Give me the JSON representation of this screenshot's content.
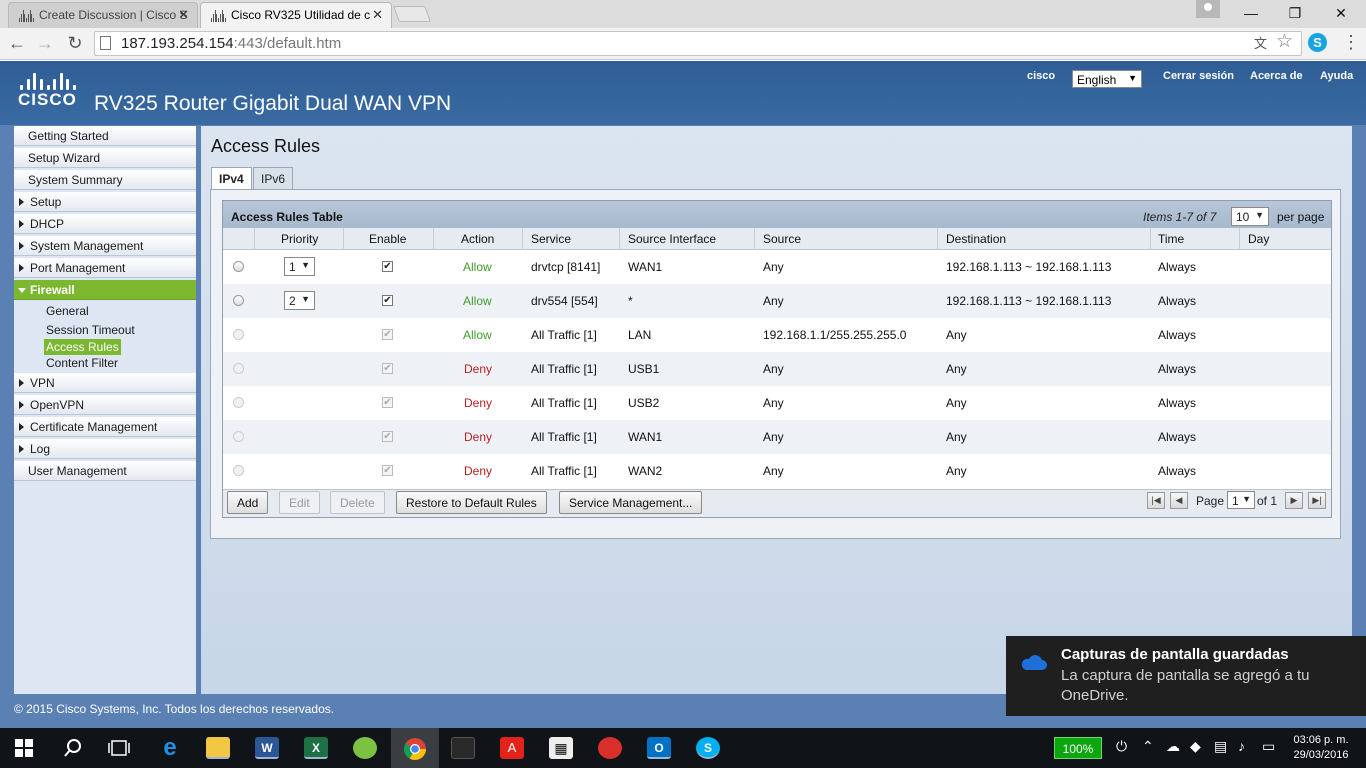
{
  "browser": {
    "tabs": [
      {
        "title": "Create Discussion | Cisco S",
        "active": false
      },
      {
        "title": "Cisco RV325 Utilidad de c",
        "active": true
      }
    ],
    "url_host": "187.193.254.154",
    "url_rest": ":443/default.htm"
  },
  "header": {
    "logo": "CISCO",
    "product": "RV325  Router Gigabit Dual WAN VPN",
    "user": "cisco",
    "language": "English",
    "logout": "Cerrar sesión",
    "about": "Acerca de",
    "help": "Ayuda"
  },
  "nav": {
    "items": [
      {
        "label": "Getting Started",
        "expandable": false
      },
      {
        "label": "Setup Wizard",
        "expandable": false
      },
      {
        "label": "System Summary",
        "expandable": false
      },
      {
        "label": "Setup",
        "expandable": true
      },
      {
        "label": "DHCP",
        "expandable": true
      },
      {
        "label": "System Management",
        "expandable": true
      },
      {
        "label": "Port Management",
        "expandable": true
      },
      {
        "label": "Firewall",
        "expandable": true,
        "active": true
      },
      {
        "label": "VPN",
        "expandable": true
      },
      {
        "label": "OpenVPN",
        "expandable": true
      },
      {
        "label": "Certificate Management",
        "expandable": true
      },
      {
        "label": "Log",
        "expandable": true
      },
      {
        "label": "User Management",
        "expandable": false
      }
    ],
    "firewall_sub": [
      "General",
      "Session Timeout",
      "Access Rules",
      "Content Filter"
    ],
    "selected_sub": "Access Rules"
  },
  "main": {
    "title": "Access Rules",
    "tabs": [
      "IPv4",
      "IPv6"
    ],
    "active_tab": "IPv4",
    "table_title": "Access Rules Table",
    "items_info": "Items 1-7 of 7",
    "per_page_value": "10",
    "per_page_label": "per page",
    "columns": [
      "Priority",
      "Enable",
      "Action",
      "Service",
      "Source Interface",
      "Source",
      "Destination",
      "Time",
      "Day"
    ],
    "rows": [
      {
        "priority": "1",
        "enabled": true,
        "editable": true,
        "action": "Allow",
        "service": "drvtcp [8141]",
        "source_interface": "WAN1",
        "source": "Any",
        "destination": "192.168.1.113 ~ 192.168.1.113",
        "time": "Always",
        "day": ""
      },
      {
        "priority": "2",
        "enabled": true,
        "editable": true,
        "action": "Allow",
        "service": "drv554 [554]",
        "source_interface": "*",
        "source": "Any",
        "destination": "192.168.1.113 ~ 192.168.1.113",
        "time": "Always",
        "day": ""
      },
      {
        "priority": "",
        "enabled": true,
        "editable": false,
        "action": "Allow",
        "service": "All Traffic [1]",
        "source_interface": "LAN",
        "source": "192.168.1.1/255.255.255.0",
        "destination": "Any",
        "time": "Always",
        "day": ""
      },
      {
        "priority": "",
        "enabled": true,
        "editable": false,
        "action": "Deny",
        "service": "All Traffic [1]",
        "source_interface": "USB1",
        "source": "Any",
        "destination": "Any",
        "time": "Always",
        "day": ""
      },
      {
        "priority": "",
        "enabled": true,
        "editable": false,
        "action": "Deny",
        "service": "All Traffic [1]",
        "source_interface": "USB2",
        "source": "Any",
        "destination": "Any",
        "time": "Always",
        "day": ""
      },
      {
        "priority": "",
        "enabled": true,
        "editable": false,
        "action": "Deny",
        "service": "All Traffic [1]",
        "source_interface": "WAN1",
        "source": "Any",
        "destination": "Any",
        "time": "Always",
        "day": ""
      },
      {
        "priority": "",
        "enabled": true,
        "editable": false,
        "action": "Deny",
        "service": "All Traffic [1]",
        "source_interface": "WAN2",
        "source": "Any",
        "destination": "Any",
        "time": "Always",
        "day": ""
      }
    ],
    "buttons": {
      "add": "Add",
      "edit": "Edit",
      "delete": "Delete",
      "restore": "Restore to Default Rules",
      "service_mgmt": "Service Management..."
    },
    "pagination": {
      "label": "Page",
      "current": "1",
      "of_label": "of 1"
    }
  },
  "footer": {
    "copyright": "© 2015 Cisco Systems, Inc. Todos los derechos reservados."
  },
  "toast": {
    "title": "Capturas de pantalla guardadas",
    "body": "La captura de pantalla se agregó a tu OneDrive."
  },
  "taskbar": {
    "battery": "100%",
    "time": "03:06 p. m.",
    "date": "29/03/2016"
  },
  "colors": {
    "accent_green": "#7bb72f",
    "header_blue": "#2e5e95",
    "allow": "#3f9b2a",
    "deny": "#b22222"
  }
}
